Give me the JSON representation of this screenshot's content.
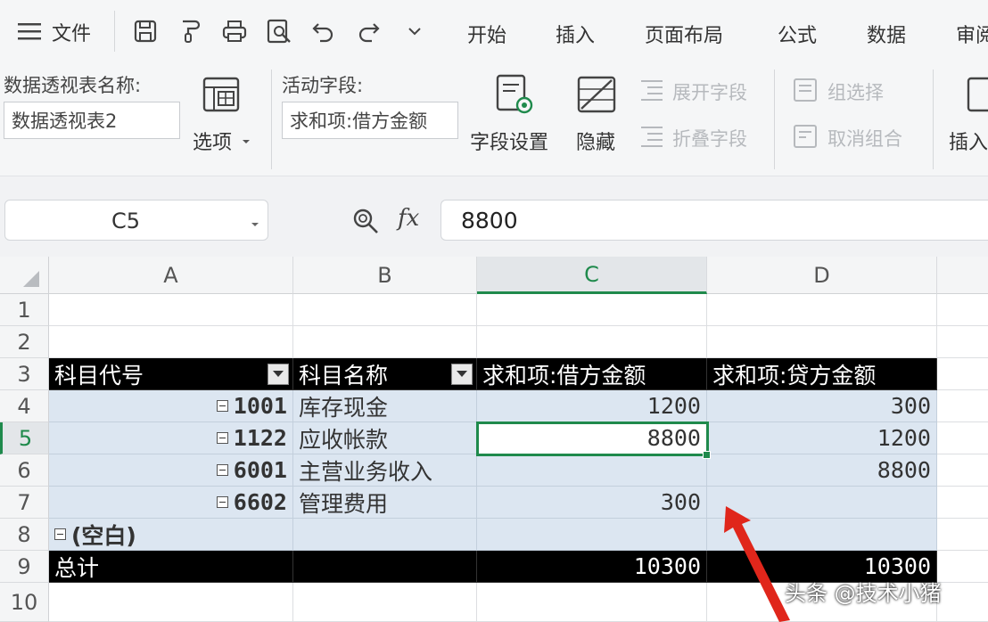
{
  "menubar": {
    "file_label": "文件",
    "tabs": [
      "开始",
      "插入",
      "页面布局",
      "公式",
      "数据",
      "审阅"
    ]
  },
  "ribbon": {
    "pivot_name_label": "数据透视表名称:",
    "pivot_name_value": "数据透视表2",
    "options_label": "选项",
    "active_field_label": "活动字段:",
    "active_field_value": "求和项:借方金额",
    "field_settings_label": "字段设置",
    "hide_label": "隐藏",
    "expand_field_label": "展开字段",
    "collapse_field_label": "折叠字段",
    "group_selection_label": "组选择",
    "ungroup_label": "取消组合",
    "insert_label": "插入"
  },
  "formulabar": {
    "name_box": "C5",
    "fx_label": "fx",
    "formula_value": "8800"
  },
  "grid": {
    "columns": [
      "A",
      "B",
      "C",
      "D"
    ],
    "active_column": "C",
    "rows": [
      "1",
      "2",
      "3",
      "4",
      "5",
      "6",
      "7",
      "8",
      "9",
      "10"
    ],
    "active_row": "5",
    "headers": {
      "a": "科目代号",
      "b": "科目名称",
      "c": "求和项:借方金额",
      "d": "求和项:贷方金额"
    },
    "data_rows": [
      {
        "code": "1001",
        "name": "库存现金",
        "debit": "1200",
        "credit": "300"
      },
      {
        "code": "1122",
        "name": "应收帐款",
        "debit": "8800",
        "credit": "1200"
      },
      {
        "code": "6001",
        "name": "主营业务收入",
        "debit": "",
        "credit": "8800"
      },
      {
        "code": "6602",
        "name": "管理费用",
        "debit": "300",
        "credit": ""
      }
    ],
    "blank_label": "(空白)",
    "total_row": {
      "label": "总计",
      "debit": "10300",
      "credit": "10300"
    }
  },
  "watermark": "头条 @技术小猪",
  "colors": {
    "accent_green": "#1f8a4c",
    "pivot_blue": "#dce6f1",
    "header_black": "#000000",
    "arrow_red": "#e0261b"
  }
}
